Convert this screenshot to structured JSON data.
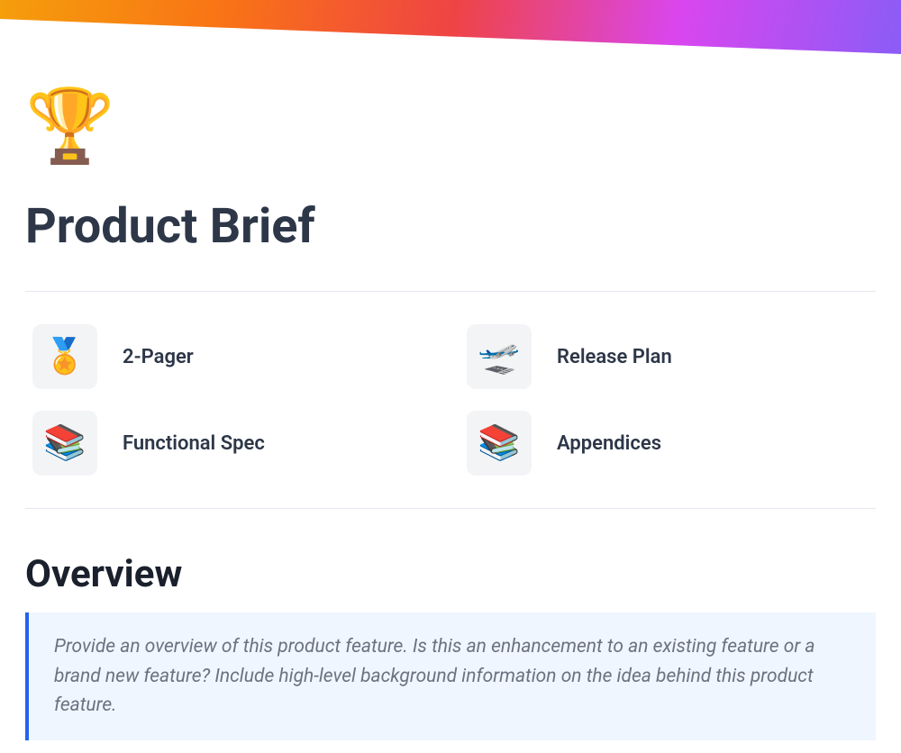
{
  "page": {
    "icon": "🏆",
    "title": "Product Brief"
  },
  "nav": {
    "items": [
      {
        "icon": "🏅",
        "label": "2-Pager"
      },
      {
        "icon": "🛫",
        "label": "Release Plan"
      },
      {
        "icon": "📚",
        "label": "Functional Spec"
      },
      {
        "icon": "📚",
        "label": "Appendices"
      }
    ]
  },
  "overview": {
    "heading": "Overview",
    "callout": "Provide an overview of this product feature. Is this an enhancement to an existing feature or a brand new feature? Include high-level background information on the idea behind this product feature."
  }
}
